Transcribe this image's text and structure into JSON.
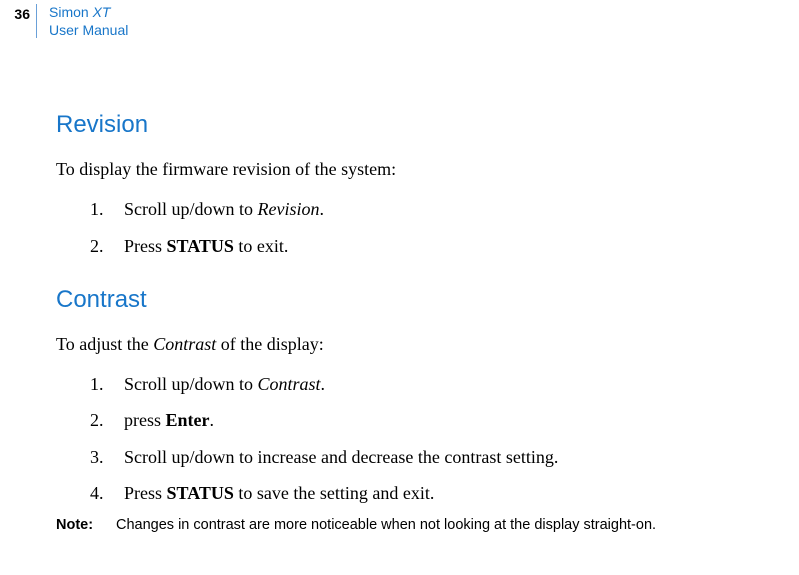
{
  "header": {
    "page_number": "36",
    "line1_a": "Simon ",
    "line1_b": "XT",
    "line2": "User Manual"
  },
  "section1": {
    "heading": "Revision",
    "intro": "To display the firmware revision of the system:",
    "steps": [
      {
        "num": "1.",
        "pre": "Scroll up/down to ",
        "em": "Revision",
        "post": "."
      },
      {
        "num": "2.",
        "pre": "Press ",
        "strong": "STATUS",
        "post": " to exit."
      }
    ]
  },
  "section2": {
    "heading": "Contrast",
    "intro_pre": "To adjust the ",
    "intro_em": "Contrast",
    "intro_post": " of the display:",
    "steps": [
      {
        "num": "1.",
        "pre": "Scroll up/down to ",
        "em": "Contrast",
        "post": "."
      },
      {
        "num": "2.",
        "pre": "press ",
        "strong": "Enter",
        "post": "."
      },
      {
        "num": "3.",
        "pre": "Scroll up/down to increase and decrease the contrast setting.",
        "post": ""
      },
      {
        "num": "4.",
        "pre": "Press ",
        "strong": "STATUS",
        "post": " to save the setting and exit."
      }
    ],
    "note_label": "Note:",
    "note_text": "Changes in contrast are more noticeable when not looking at the display straight-on."
  }
}
